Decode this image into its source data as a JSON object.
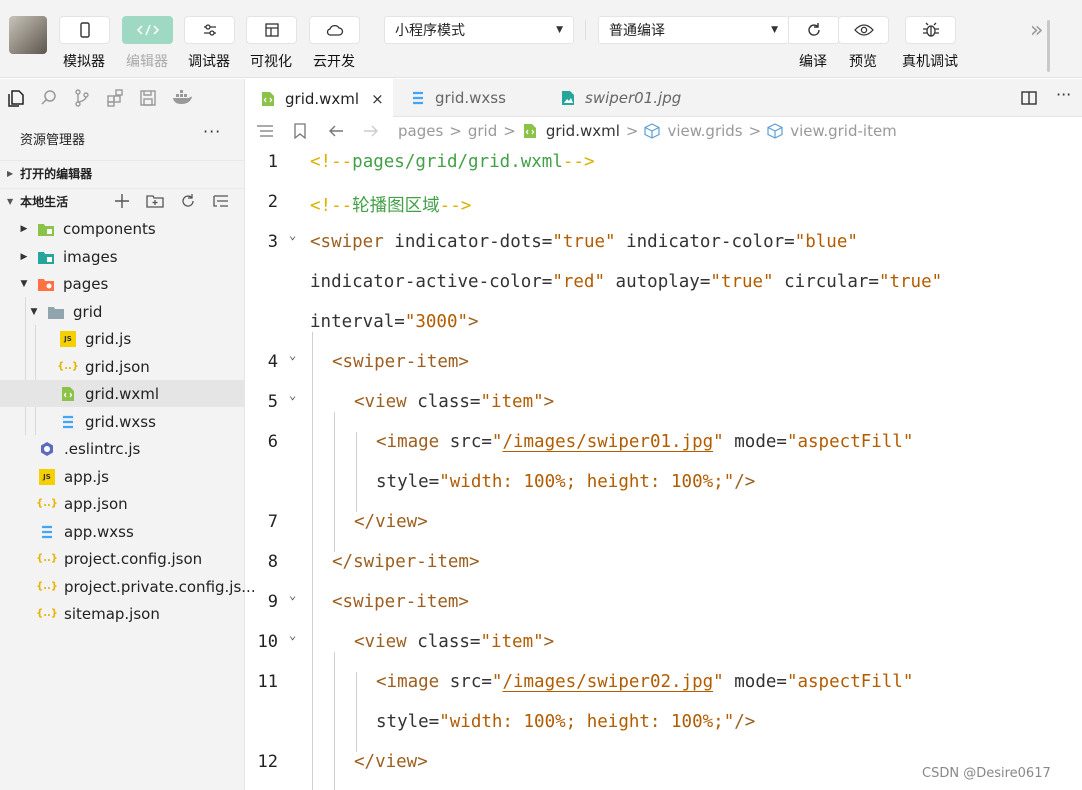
{
  "toolbar": {
    "buttons": [
      {
        "label": "模拟器",
        "icon": "phone-icon"
      },
      {
        "label": "编辑器",
        "icon": "code-icon"
      },
      {
        "label": "调试器",
        "icon": "sliders-icon"
      },
      {
        "label": "可视化",
        "icon": "layout-icon"
      },
      {
        "label": "云开发",
        "icon": "cloud-icon"
      }
    ],
    "mode_select": "小程序模式",
    "compile_select": "普通编译",
    "right_buttons": [
      {
        "label": "编译",
        "icon": "refresh-icon"
      },
      {
        "label": "预览",
        "icon": "eye-icon"
      },
      {
        "label": "真机调试",
        "icon": "bug-icon"
      }
    ],
    "expand_label": "»"
  },
  "sidebar": {
    "title": "资源管理器",
    "more": "···",
    "open_editors": "打开的编辑器",
    "project": "本地生活",
    "tree": [
      {
        "label": "components",
        "kind": "folder-green"
      },
      {
        "label": "images",
        "kind": "folder-teal"
      },
      {
        "label": "pages",
        "kind": "folder-orange"
      },
      {
        "label": "grid",
        "kind": "folder-gray"
      },
      {
        "label": "grid.js",
        "kind": "js"
      },
      {
        "label": "grid.json",
        "kind": "json"
      },
      {
        "label": "grid.wxml",
        "kind": "wxml"
      },
      {
        "label": "grid.wxss",
        "kind": "wxss"
      },
      {
        "label": ".eslintrc.js",
        "kind": "eslint"
      },
      {
        "label": "app.js",
        "kind": "js"
      },
      {
        "label": "app.json",
        "kind": "json"
      },
      {
        "label": "app.wxss",
        "kind": "wxss"
      },
      {
        "label": "project.config.json",
        "kind": "json"
      },
      {
        "label": "project.private.config.js...",
        "kind": "json"
      },
      {
        "label": "sitemap.json",
        "kind": "json"
      }
    ]
  },
  "tabs": [
    {
      "label": "grid.wxml",
      "close": "×"
    },
    {
      "label": "grid.wxss"
    },
    {
      "label": "swiper01.jpg"
    }
  ],
  "breadcrumb": [
    "pages",
    "grid",
    "grid.wxml",
    "view.grids",
    "view.grid-item"
  ],
  "breadcrumb_sep": ">",
  "code": {
    "line_numbers": [
      "1",
      "2",
      "3",
      "4",
      "5",
      "6",
      "7",
      "8",
      "9",
      "10",
      "11",
      "12"
    ],
    "l1": "<!--pages/grid/grid.wxml-->",
    "l2": "<!--轮播图区域-->",
    "l3a_tag": "<swiper",
    "l3a_attr1": " indicator-dots=",
    "l3a_val1": "\"true\"",
    "l3a_attr2": " indicator-color=",
    "l3a_val2": "\"blue\"",
    "l3b_attr1": "indicator-active-color=",
    "l3b_val1": "\"red\"",
    "l3b_attr2": " autoplay=",
    "l3b_val2": "\"true\"",
    "l3b_attr3": " circular=",
    "l3b_val3": "\"true\"",
    "l3c_attr": "interval=",
    "l3c_val": "\"3000\"",
    "l3c_end": ">",
    "swiper_item_open": "<swiper-item>",
    "swiper_item_close": "</swiper-item>",
    "view_tag": "<view",
    "view_attr": " class=",
    "view_val": "\"item\"",
    "view_end": ">",
    "view_close": "</view>",
    "img_tag": "<image",
    "img_attr": " src=",
    "img_src1": "/images/swiper01.jpg",
    "img_src2": "/images/swiper02.jpg",
    "quote": "\"",
    "img_mode_attr": " mode=",
    "img_mode_val": "\"aspectFill\"",
    "style_attr": "style=",
    "style_val": "\"width: 100%; height: 100%;\"",
    "self_close": "/>"
  },
  "watermark": "CSDN @Desire0617"
}
